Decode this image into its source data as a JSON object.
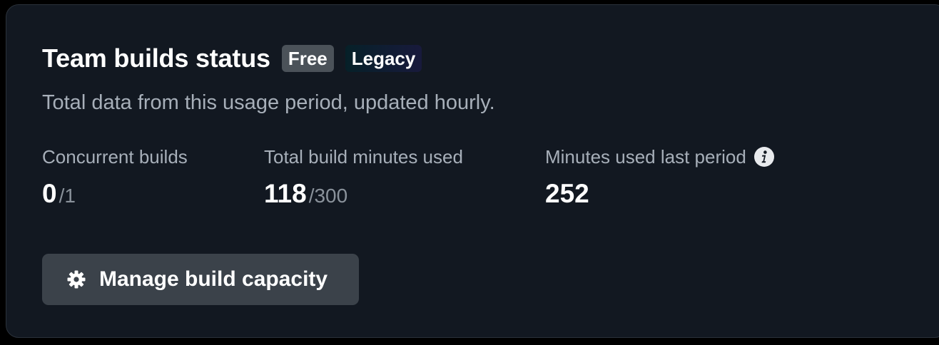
{
  "card": {
    "title": "Team builds status",
    "badges": {
      "free": "Free",
      "legacy": "Legacy"
    },
    "subtitle": "Total data from this usage period, updated hourly."
  },
  "stats": [
    {
      "label": "Concurrent builds",
      "value": "0",
      "total": "/1"
    },
    {
      "label": "Total build minutes used",
      "value": "118",
      "total": "/300"
    },
    {
      "label": "Minutes used last period",
      "value": "252",
      "icon": "info-icon"
    }
  ],
  "actions": {
    "manage_label": "Manage build capacity",
    "manage_icon": "gear-icon"
  },
  "colors": {
    "background": "#121821",
    "border": "#2b323b",
    "button": "#3b424a",
    "badge_free": "#4b5259",
    "muted_text": "#a7afb9"
  }
}
